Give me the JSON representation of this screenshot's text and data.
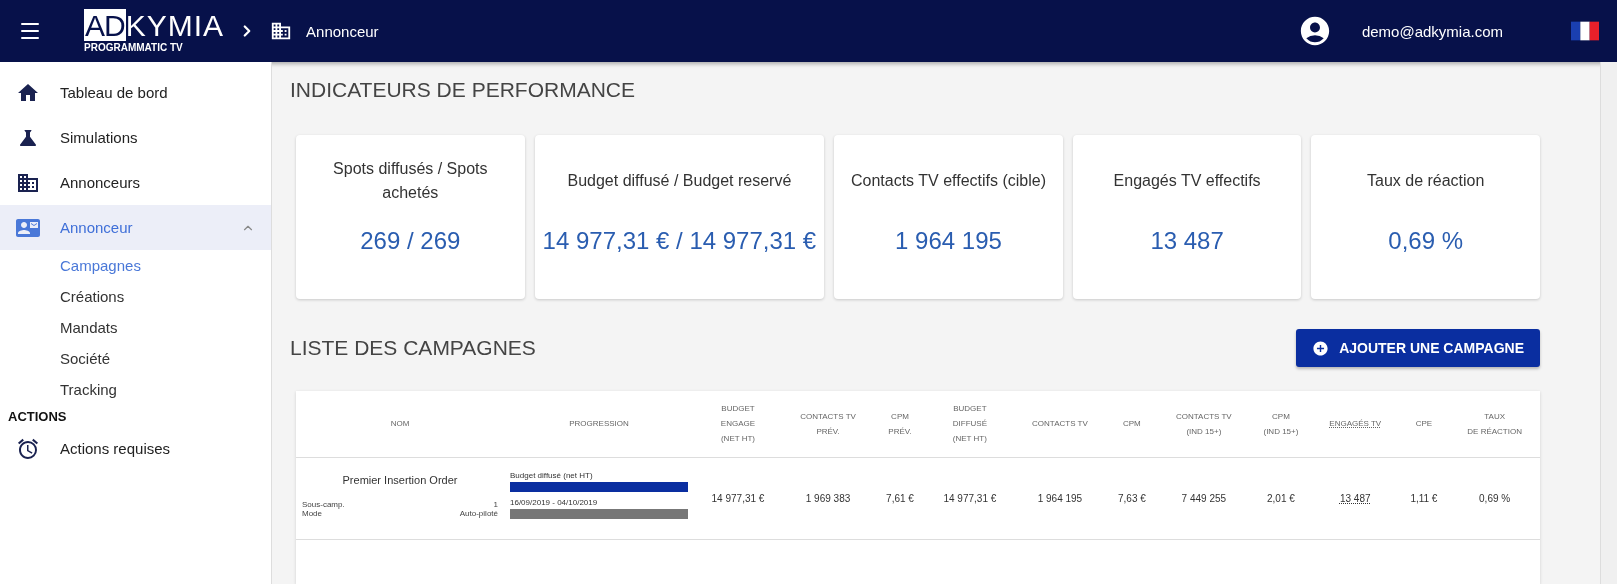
{
  "topbar": {
    "logo": {
      "mark": "AD",
      "name": "KYMIA",
      "tagline": "PROGRAMMATIC TV"
    },
    "breadcrumb": "Annonceur",
    "user": "demo@adkymia.com"
  },
  "sidebar": {
    "items": [
      {
        "label": "Tableau de bord",
        "selected": false
      },
      {
        "label": "Simulations",
        "selected": false
      },
      {
        "label": "Annonceurs",
        "selected": false
      },
      {
        "label": "Annonceur",
        "selected": true,
        "expanded": true,
        "children": [
          {
            "label": "Campagnes",
            "selected": true
          },
          {
            "label": "Créations",
            "selected": false
          },
          {
            "label": "Mandats",
            "selected": false
          },
          {
            "label": "Société",
            "selected": false
          },
          {
            "label": "Tracking",
            "selected": false
          }
        ]
      }
    ],
    "section": "ACTIONS",
    "actions": [
      {
        "label": "Actions requises",
        "selected": false
      }
    ]
  },
  "kpi": {
    "title": "INDICATEURS DE PERFORMANCE",
    "cards": [
      {
        "label": "Spots diffusés / Spots achetés",
        "value": "269 / 269"
      },
      {
        "label": "Budget diffusé / Budget reservé",
        "value": "14 977,31 € / 14 977,31 €"
      },
      {
        "label": "Contacts TV effectifs (cible)",
        "value": "1 964 195"
      },
      {
        "label": "Engagés TV effectifs",
        "value": "13 487"
      },
      {
        "label": "Taux de réaction",
        "value": "0,69 %"
      }
    ]
  },
  "campaigns": {
    "title": "LISTE DES CAMPAGNES",
    "add_button": "AJOUTER UNE CAMPAGNE",
    "table": {
      "columns": [
        {
          "label": "NOM",
          "dotted": false
        },
        {
          "label": "PROGRESSION",
          "dotted": false
        },
        {
          "label": "BUDGET\nENGAGE\n(NET HT)",
          "dotted": false
        },
        {
          "label": "CONTACTS TV\nPRÉV.",
          "dotted": false
        },
        {
          "label": "CPM\nPRÉV.",
          "dotted": false
        },
        {
          "label": "BUDGET\nDIFFUSÉ\n(NET HT)",
          "dotted": false
        },
        {
          "label": "CONTACTS TV",
          "dotted": false
        },
        {
          "label": "CPM",
          "dotted": false
        },
        {
          "label": "CONTACTS TV\n(IND 15+)",
          "dotted": false
        },
        {
          "label": "CPM\n(IND 15+)",
          "dotted": false
        },
        {
          "label": "ENGAGÉS TV",
          "dotted": true
        },
        {
          "label": "CPE",
          "dotted": false
        },
        {
          "label": "TAUX\nDE RÉACTION",
          "dotted": false
        }
      ],
      "rows": [
        {
          "cells": [
            {
              "kind": "name",
              "name": "Premier Insertion Order",
              "details": [
                {
                  "label": "Sous-camp.",
                  "value": "1"
                },
                {
                  "label": "Mode",
                  "value": "Auto-piloté"
                }
              ]
            },
            {
              "kind": "progress",
              "bars": [
                {
                  "label": "Budget diffusé (net HT)",
                  "level": 1,
                  "color": "#0a2ea0"
                },
                {
                  "label": "16/09/2019 - 04/10/2019",
                  "level": 1,
                  "color": "#777777"
                }
              ]
            },
            {
              "kind": "text",
              "text": "14 977,31 €"
            },
            {
              "kind": "text",
              "text": "1 969 383"
            },
            {
              "kind": "text",
              "text": "7,61 €"
            },
            {
              "kind": "text",
              "text": "14 977,31 €"
            },
            {
              "kind": "text",
              "text": "1 964 195"
            },
            {
              "kind": "text",
              "text": "7,63 €"
            },
            {
              "kind": "text",
              "text": "7 449 255"
            },
            {
              "kind": "text",
              "text": "2,01 €"
            },
            {
              "kind": "text",
              "text": "13 487"
            },
            {
              "kind": "text",
              "text": "1,11 €"
            },
            {
              "kind": "text",
              "text": "0,69 %"
            }
          ]
        }
      ]
    }
  }
}
